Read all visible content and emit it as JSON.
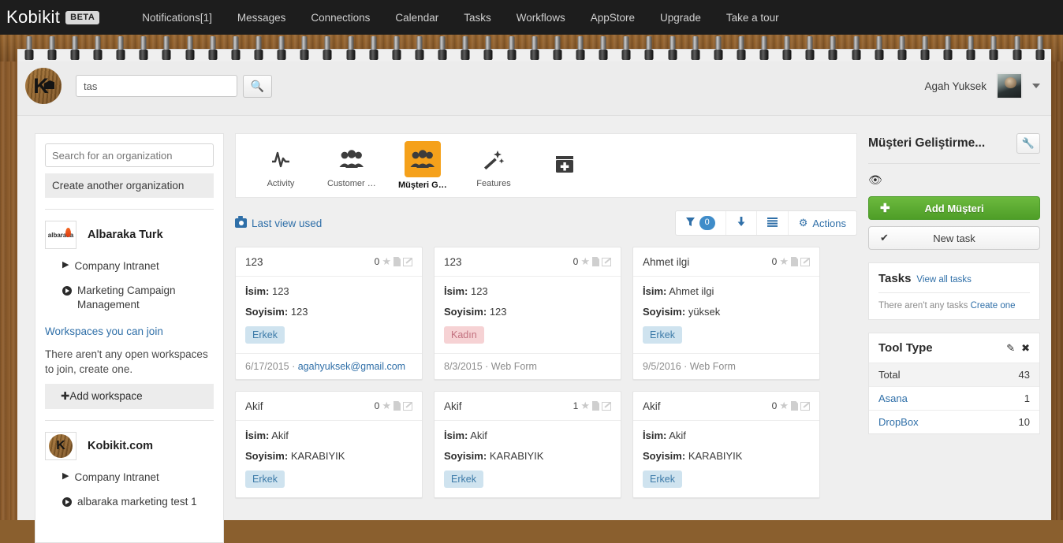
{
  "topnav": {
    "brand": "Kobikit",
    "badge": "BETA",
    "items": [
      {
        "label": "Notifications[1]"
      },
      {
        "label": "Messages"
      },
      {
        "label": "Connections"
      },
      {
        "label": "Calendar"
      },
      {
        "label": "Tasks"
      },
      {
        "label": "Workflows"
      },
      {
        "label": "AppStore"
      },
      {
        "label": "Upgrade"
      },
      {
        "label": "Take a tour"
      }
    ]
  },
  "subheader": {
    "logo_letter": "K",
    "search_value": "tas",
    "search_icon": "search-icon",
    "user_name": "Agah Yuksek"
  },
  "org_panel": {
    "search_placeholder": "Search for an organization",
    "create_label": "Create another organization",
    "organizations": [
      {
        "name": "Albaraka Turk",
        "logo_text": "albaraka",
        "workspaces": [
          {
            "label": "Company Intranet",
            "icon": "triangle-right-icon"
          },
          {
            "label": "Marketing Campaign Management",
            "icon": "play-circle-icon"
          }
        ]
      }
    ],
    "join_link": "Workspaces you can join",
    "empty_note": "There aren't any open workspaces to join, create one.",
    "add_workspace": "Add workspace",
    "org2": {
      "name": "Kobikit.com",
      "logo_letter": "K",
      "workspaces": [
        {
          "label": "Company Intranet",
          "icon": "triangle-right-icon"
        },
        {
          "label": "albaraka marketing test 1",
          "icon": "play-circle-icon"
        }
      ]
    }
  },
  "app_bar": {
    "tiles": [
      {
        "label": "Activity",
        "icon": "activity-pulse-icon",
        "glyph": "ᴧ",
        "active": false
      },
      {
        "label": "Customer Di...",
        "icon": "people-group-icon",
        "glyph": "👥",
        "active": false
      },
      {
        "label": "Müşteri Geli...",
        "icon": "people-group-icon",
        "glyph": "👥",
        "active": true
      },
      {
        "label": "Features",
        "icon": "magic-wand-icon",
        "glyph": "✨",
        "active": false
      },
      {
        "label": "",
        "icon": "add-app-icon",
        "glyph": "✚",
        "active": false
      }
    ]
  },
  "view_bar": {
    "last_view_label": "Last view used",
    "last_view_icon": "camera-icon",
    "filter_icon": "funnel-icon",
    "filter_count": "0",
    "download_icon": "download-arrow-icon",
    "list_icon": "list-view-icon",
    "actions_icon": "gear-icon",
    "actions_label": "Actions"
  },
  "cards": [
    {
      "title": "123",
      "count": "0",
      "isim_label": "İsim:",
      "isim_value": "123",
      "soyisim_label": "Soyisim:",
      "soyisim_value": "123",
      "tag": "Erkek",
      "tag_type": "male",
      "date": "6/17/2015",
      "source": "agahyuksek@gmail.com",
      "source_link": true
    },
    {
      "title": "123",
      "count": "0",
      "isim_label": "İsim:",
      "isim_value": "123",
      "soyisim_label": "Soyisim:",
      "soyisim_value": "123",
      "tag": "Kadın",
      "tag_type": "female",
      "date": "8/3/2015",
      "source": "Web Form",
      "source_link": false
    },
    {
      "title": "Ahmet ilgi",
      "count": "0",
      "isim_label": "İsim:",
      "isim_value": "Ahmet ilgi",
      "soyisim_label": "Soyisim:",
      "soyisim_value": "yüksek",
      "tag": "Erkek",
      "tag_type": "male",
      "date": "9/5/2016",
      "source": "Web Form",
      "source_link": false
    },
    {
      "title": "Akif",
      "count": "0",
      "isim_label": "İsim:",
      "isim_value": "Akif",
      "soyisim_label": "Soyisim:",
      "soyisim_value": "KARABIYIK",
      "tag": "Erkek",
      "tag_type": "male",
      "date": "",
      "source": "",
      "source_link": false
    },
    {
      "title": "Akif",
      "count": "1",
      "isim_label": "İsim:",
      "isim_value": "Akif",
      "soyisim_label": "Soyisim:",
      "soyisim_value": "KARABIYIK",
      "tag": "Erkek",
      "tag_type": "male",
      "date": "",
      "source": "",
      "source_link": false
    },
    {
      "title": "Akif",
      "count": "0",
      "isim_label": "İsim:",
      "isim_value": "Akif",
      "soyisim_label": "Soyisim:",
      "soyisim_value": "KARABIYIK",
      "tag": "Erkek",
      "tag_type": "male",
      "date": "",
      "source": "",
      "source_link": false
    }
  ],
  "right_panel": {
    "title": "Müşteri Geliştirme...",
    "wrench_icon": "wrench-icon",
    "eye_icon": "eye-icon",
    "add_button": "Add Müşteri",
    "add_button_icon": "plus-icon",
    "new_task_button": "New task",
    "new_task_icon": "check-icon",
    "tasks": {
      "title": "Tasks",
      "view_all": "View all tasks",
      "empty_text": "There aren't any tasks",
      "empty_link": "Create one"
    },
    "tool_type": {
      "title": "Tool Type",
      "edit_icon": "edit-icon",
      "close_icon": "close-icon",
      "rows": [
        {
          "name": "Total",
          "value": "43",
          "total": true
        },
        {
          "name": "Asana",
          "value": "1",
          "total": false
        },
        {
          "name": "DropBox",
          "value": "10",
          "total": false
        }
      ]
    }
  },
  "colors": {
    "accent_blue": "#2f6fa8",
    "badge_blue": "#3f8cc9",
    "active_orange": "#f5a11b",
    "green_button": "#4e9e27",
    "tag_male_bg": "#cfe3ef",
    "tag_female_bg": "#f6d2d4",
    "wood": "#8d5c2c"
  }
}
